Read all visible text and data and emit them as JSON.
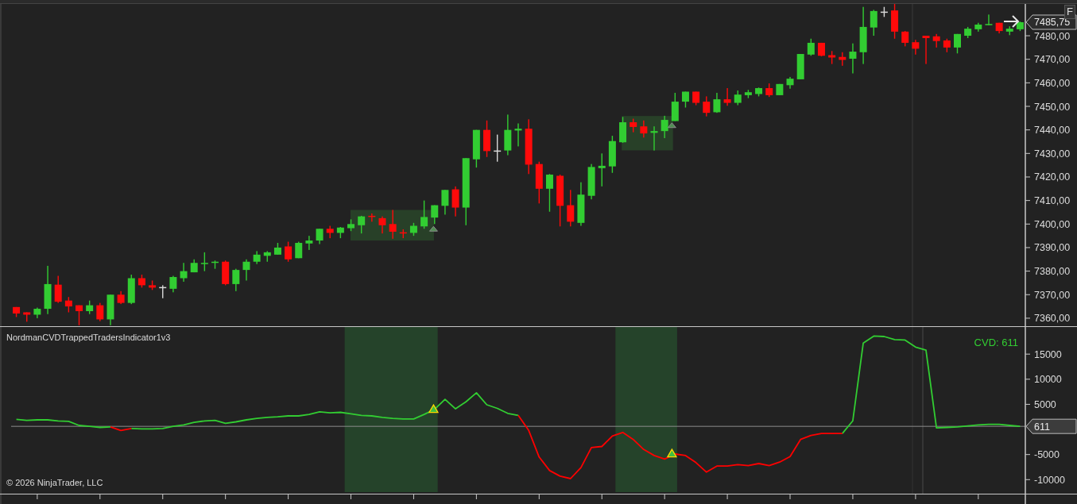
{
  "price_panel": {
    "button": "F",
    "price_tag": "7485,75",
    "chart_data": {
      "type": "candlestick",
      "ylim": [
        7356.6,
        7493.5
      ],
      "categories": [
        null,
        null,
        null,
        null,
        null,
        null,
        null,
        null,
        null,
        null,
        null,
        null,
        null,
        null,
        null,
        null,
        null,
        null,
        null,
        null,
        null,
        null,
        null,
        null,
        null,
        null,
        null,
        null,
        null,
        null,
        null,
        null,
        null,
        null,
        null,
        null,
        null,
        null,
        null,
        null,
        null,
        null,
        null,
        null,
        null,
        null,
        null,
        null,
        null,
        null,
        null,
        null,
        null,
        null,
        null,
        null,
        null,
        null,
        null,
        null,
        null,
        null,
        null,
        null,
        null,
        null,
        null,
        null,
        null,
        null,
        null,
        null,
        null,
        null,
        null,
        null,
        null,
        null,
        null,
        null,
        null,
        null,
        null,
        null,
        null,
        null,
        null,
        null,
        null,
        null,
        null,
        null,
        null,
        null,
        null,
        null,
        null
      ],
      "yticks": [
        {
          "value": 7360,
          "label": "7360,00"
        },
        {
          "value": 7370,
          "label": "7370,00"
        },
        {
          "value": 7380,
          "label": "7380,00"
        },
        {
          "value": 7390,
          "label": "7390,00"
        },
        {
          "value": 7400,
          "label": "7400,00"
        },
        {
          "value": 7410,
          "label": "7410,00"
        },
        {
          "value": 7420,
          "label": "7420,00"
        },
        {
          "value": 7430,
          "label": "7430,00"
        },
        {
          "value": 7440,
          "label": "7440,00"
        },
        {
          "value": 7450,
          "label": "7450,00"
        },
        {
          "value": 7460,
          "label": "7460,00"
        },
        {
          "value": 7470,
          "label": "7470,00"
        },
        {
          "value": 7480,
          "label": "7480,00"
        }
      ],
      "ohlc": [
        [
          7364.75,
          7364.75,
          7360.5,
          7362
        ],
        [
          7362.5,
          7362.5,
          7358.5,
          7361.5
        ],
        [
          7361.5,
          7364.5,
          7360,
          7364
        ],
        [
          7364,
          7382.25,
          7361.75,
          7374.5
        ],
        [
          7374.25,
          7378,
          7366.5,
          7367
        ],
        [
          7367.5,
          7369,
          7362.5,
          7365
        ],
        [
          7365.5,
          7365.5,
          7357,
          7363
        ],
        [
          7363,
          7367.5,
          7361.75,
          7365.5
        ],
        [
          7365.5,
          7366.5,
          7358.75,
          7359.5
        ],
        [
          7359.5,
          7370,
          7357,
          7370
        ],
        [
          7370,
          7371.5,
          7366,
          7366.5
        ],
        [
          7366.5,
          7378.5,
          7366,
          7377
        ],
        [
          7377,
          7378.5,
          7373,
          7374
        ],
        [
          7374,
          7376,
          7372,
          7373
        ],
        [
          7373.25,
          7374,
          7368.5,
          7373.25
        ],
        [
          7372.5,
          7378,
          7371,
          7377.5
        ],
        [
          7377,
          7383.5,
          7375.5,
          7380
        ],
        [
          7379.5,
          7385,
          7379.5,
          7383.5
        ],
        [
          7383,
          7388,
          7380,
          7383.5
        ],
        [
          7383.5,
          7384.5,
          7381,
          7384
        ],
        [
          7384,
          7384.5,
          7374,
          7374.5
        ],
        [
          7374.5,
          7381,
          7371.5,
          7380.5
        ],
        [
          7380.5,
          7385,
          7376,
          7384
        ],
        [
          7384,
          7388.5,
          7383,
          7387
        ],
        [
          7386.5,
          7388.5,
          7384,
          7388
        ],
        [
          7387,
          7392,
          7387,
          7390
        ],
        [
          7390.5,
          7392.5,
          7384,
          7385
        ],
        [
          7385.5,
          7392.5,
          7385.5,
          7392
        ],
        [
          7391.75,
          7395,
          7389,
          7393
        ],
        [
          7393,
          7398,
          7391.5,
          7398
        ],
        [
          7398,
          7399.25,
          7394,
          7396.25
        ],
        [
          7396.25,
          7398.75,
          7394,
          7398.5
        ],
        [
          7398.25,
          7402,
          7397,
          7400
        ],
        [
          7399.5,
          7403.5,
          7396,
          7403.25
        ],
        [
          7403.5,
          7404.5,
          7401,
          7403
        ],
        [
          7402.5,
          7403.25,
          7396,
          7399.5
        ],
        [
          7400,
          7406,
          7393.75,
          7396.75
        ],
        [
          7396.5,
          7397.75,
          7394,
          7396
        ],
        [
          7396.25,
          7400.5,
          7395,
          7399.25
        ],
        [
          7399,
          7410,
          7398,
          7403
        ],
        [
          7402.75,
          7408,
          7400,
          7408
        ],
        [
          7407.75,
          7414.5,
          7404,
          7414.5
        ],
        [
          7414.75,
          7416,
          7403.25,
          7407
        ],
        [
          7407,
          7428,
          7399.5,
          7428
        ],
        [
          7427.5,
          7440,
          7424,
          7440
        ],
        [
          7440,
          7444,
          7428.5,
          7431
        ],
        [
          7431.25,
          7438,
          7426.5,
          7431.25
        ],
        [
          7431.25,
          7446.5,
          7429.25,
          7440
        ],
        [
          7439.75,
          7442.75,
          7433,
          7440.5
        ],
        [
          7440.5,
          7444.5,
          7421.25,
          7425.25
        ],
        [
          7425.5,
          7426.5,
          7408.75,
          7415
        ],
        [
          7415,
          7421.25,
          7405.25,
          7421
        ],
        [
          7420.5,
          7421,
          7399,
          7407.75
        ],
        [
          7408,
          7414.5,
          7399,
          7401
        ],
        [
          7400.5,
          7417.75,
          7399.25,
          7412.5
        ],
        [
          7412,
          7425.5,
          7410.5,
          7424.25
        ],
        [
          7423.75,
          7430,
          7416,
          7424.75
        ],
        [
          7424.5,
          7437.5,
          7421.75,
          7435.25
        ],
        [
          7434.75,
          7445.5,
          7434.5,
          7443.25
        ],
        [
          7443.25,
          7444.75,
          7439,
          7441.25
        ],
        [
          7441.5,
          7444,
          7436.75,
          7438.5
        ],
        [
          7438.75,
          7441.5,
          7431.25,
          7439.5
        ],
        [
          7439.5,
          7446,
          7436.5,
          7444.25
        ],
        [
          7443.75,
          7455.75,
          7443.75,
          7452
        ],
        [
          7452,
          7456.25,
          7449.5,
          7456.25
        ],
        [
          7456.25,
          7456.25,
          7450.5,
          7451.5
        ],
        [
          7452,
          7454.25,
          7445.75,
          7447.25
        ],
        [
          7447.5,
          7455.75,
          7447.25,
          7453
        ],
        [
          7453,
          7457.75,
          7450.25,
          7451.5
        ],
        [
          7451.5,
          7456.75,
          7450.5,
          7455
        ],
        [
          7454.75,
          7457,
          7453.5,
          7456
        ],
        [
          7455.25,
          7458,
          7454.25,
          7457.75
        ],
        [
          7457.75,
          7459.75,
          7454,
          7454.75
        ],
        [
          7454.75,
          7459.5,
          7454.75,
          7459.5
        ],
        [
          7459,
          7462.5,
          7457.5,
          7461.75
        ],
        [
          7461.5,
          7472.25,
          7461.5,
          7472.25
        ],
        [
          7472,
          7478.75,
          7471.5,
          7477
        ],
        [
          7477,
          7477,
          7471.25,
          7471.5
        ],
        [
          7471.75,
          7473.5,
          7468,
          7470.75
        ],
        [
          7471,
          7473,
          7467.25,
          7469.75
        ],
        [
          7470.25,
          7476.75,
          7464,
          7473.25
        ],
        [
          7473,
          7492.25,
          7468,
          7483.75
        ],
        [
          7483.5,
          7491,
          7480,
          7490.5
        ],
        [
          7490.25,
          7492.25,
          7488,
          7490.25
        ],
        [
          7490.75,
          7493.5,
          7478.75,
          7481.75
        ],
        [
          7481.75,
          7482,
          7475.5,
          7477
        ],
        [
          7477.25,
          7478.25,
          7472,
          7474.5
        ],
        [
          7480,
          7480,
          7468,
          7479
        ],
        [
          7479.75,
          7480.75,
          7475,
          7477.75
        ],
        [
          7478,
          7478.75,
          7473,
          7475
        ],
        [
          7475,
          7480.75,
          7472.5,
          7480.75
        ],
        [
          7480,
          7483.75,
          7479,
          7483
        ],
        [
          7482.75,
          7485.5,
          7481.75,
          7484.75
        ],
        [
          7484.5,
          7489,
          7484.5,
          7485
        ],
        [
          7485.5,
          7485.5,
          7481,
          7482
        ],
        [
          7481.75,
          7484,
          7480.25,
          7483
        ],
        [
          7482.75,
          7486,
          7482,
          7485.75
        ]
      ]
    }
  },
  "indicator_panel": {
    "title": "NordmanCVDTrappedTradersIndicator1v3",
    "readout": "CVD: 611",
    "value_tag": "611",
    "chart_data": {
      "type": "line",
      "ylim": [
        -12800,
        20400
      ],
      "ref_lines": [
        {
          "axis": "y",
          "value": 611
        }
      ],
      "categories": [
        null,
        null,
        null,
        null,
        null,
        null,
        null,
        null,
        null,
        null,
        null,
        null,
        null,
        null,
        null,
        null,
        null,
        null,
        null,
        null,
        null,
        null,
        null,
        null,
        null,
        null,
        null,
        null,
        null,
        null,
        null,
        null,
        null,
        null,
        null,
        null,
        null,
        null,
        null,
        null,
        null,
        null,
        null,
        null,
        null,
        null,
        null,
        null,
        null,
        null,
        null,
        null,
        null,
        null,
        null,
        null,
        null,
        null,
        null,
        null,
        null,
        null,
        null,
        null,
        null,
        null,
        null,
        null,
        null,
        null,
        null,
        null,
        null,
        null,
        null,
        null,
        null,
        null,
        null,
        null,
        null,
        null,
        null,
        null,
        null,
        null,
        null,
        null,
        null,
        null,
        null,
        null,
        null,
        null,
        null,
        null,
        null
      ],
      "yticks": [
        {
          "value": -10000,
          "label": "-10000"
        },
        {
          "value": -5000,
          "label": "-5000"
        },
        {
          "value": 5000,
          "label": "5000"
        },
        {
          "value": 10000,
          "label": "10000"
        },
        {
          "value": 15000,
          "label": "15000"
        }
      ],
      "series": [
        {
          "color": "#32cd32",
          "values": [
            2000,
            1800,
            1900,
            1900,
            1700,
            1600,
            800,
            600,
            400,
            500,
            null,
            200,
            100,
            100,
            200,
            600,
            900,
            1400,
            1700,
            1800,
            1200,
            1500,
            1900,
            2200,
            2400,
            2500,
            2700,
            2700,
            3000,
            3500,
            3300,
            3400,
            3100,
            2800,
            2700,
            2400,
            2200,
            2100,
            2100,
            3000,
            4000,
            6000,
            4100,
            5500,
            7300,
            4900,
            4200,
            3200,
            2800,
            null,
            null,
            null,
            null,
            null,
            null,
            null,
            null,
            null,
            null,
            null,
            null,
            null,
            null,
            null,
            null,
            null,
            null,
            null,
            null,
            null,
            null,
            null,
            null,
            null,
            null,
            null,
            null,
            null,
            null,
            -800,
            1700,
            17200,
            18600,
            18500,
            17900,
            17800,
            16400,
            15800,
            300,
            400,
            500,
            700,
            900,
            1000,
            1000,
            800,
            611
          ]
        },
        {
          "color": "#ff0000",
          "values": [
            null,
            null,
            null,
            null,
            null,
            null,
            null,
            null,
            null,
            500,
            -200,
            200,
            null,
            null,
            null,
            null,
            null,
            null,
            null,
            null,
            null,
            null,
            null,
            null,
            null,
            null,
            null,
            null,
            null,
            null,
            null,
            null,
            null,
            null,
            null,
            null,
            null,
            null,
            null,
            null,
            null,
            null,
            null,
            null,
            null,
            null,
            null,
            null,
            2800,
            -200,
            -5500,
            -8200,
            -9300,
            -9800,
            -7600,
            -3600,
            -3400,
            -1300,
            -600,
            -2000,
            -4000,
            -5200,
            -5900,
            -4900,
            -5200,
            -6600,
            -8500,
            -7300,
            -7300,
            -7000,
            -7200,
            -6800,
            -7200,
            -6500,
            -5400,
            -2000,
            -1200,
            -800,
            -800,
            -800,
            null,
            null,
            null,
            null,
            null,
            null,
            null,
            null,
            null,
            null,
            null,
            null,
            null,
            null,
            null,
            null,
            null
          ]
        }
      ]
    }
  },
  "copyright": "© 2026 NinjaTrader, LLC"
}
